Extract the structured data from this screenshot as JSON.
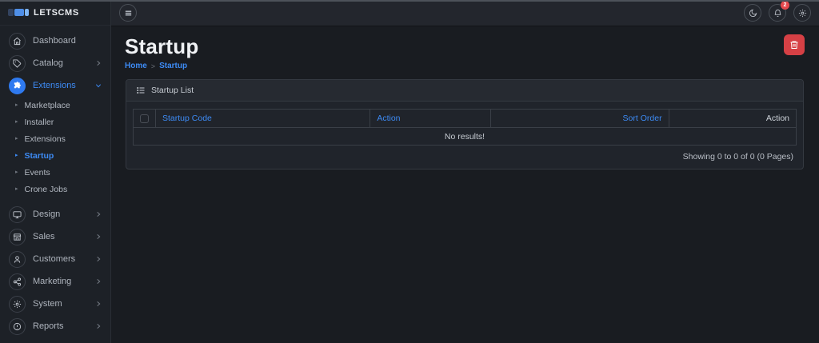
{
  "brand": {
    "name": "LETSCMS"
  },
  "topbar": {
    "notification_count": "2"
  },
  "sidebar": {
    "main_items": [
      {
        "label": "Dashboard"
      },
      {
        "label": "Catalog"
      },
      {
        "label": "Extensions"
      },
      {
        "label": "Design"
      },
      {
        "label": "Sales"
      },
      {
        "label": "Customers"
      },
      {
        "label": "Marketing"
      },
      {
        "label": "System"
      },
      {
        "label": "Reports"
      }
    ],
    "submenu": [
      {
        "label": "Marketplace"
      },
      {
        "label": "Installer"
      },
      {
        "label": "Extensions"
      },
      {
        "label": "Startup"
      },
      {
        "label": "Events"
      },
      {
        "label": "Crone Jobs"
      }
    ]
  },
  "page": {
    "title": "Startup",
    "breadcrumb_home": "Home",
    "breadcrumb_current": "Startup"
  },
  "panel": {
    "title": "Startup List",
    "columns": {
      "code": "Startup Code",
      "action1": "Action",
      "sort": "Sort Order",
      "action2": "Action"
    },
    "empty_text": "No results!",
    "pagination_text": "Showing 0 to 0 of 0 (0 Pages)"
  },
  "colors": {
    "accent_blue": "#3d8bf5",
    "danger_red": "#d64045",
    "badge_red": "#e5484d",
    "sidebar_bg": "#1d2127",
    "topbar_bg": "#23262d",
    "content_bg": "#191c21"
  }
}
